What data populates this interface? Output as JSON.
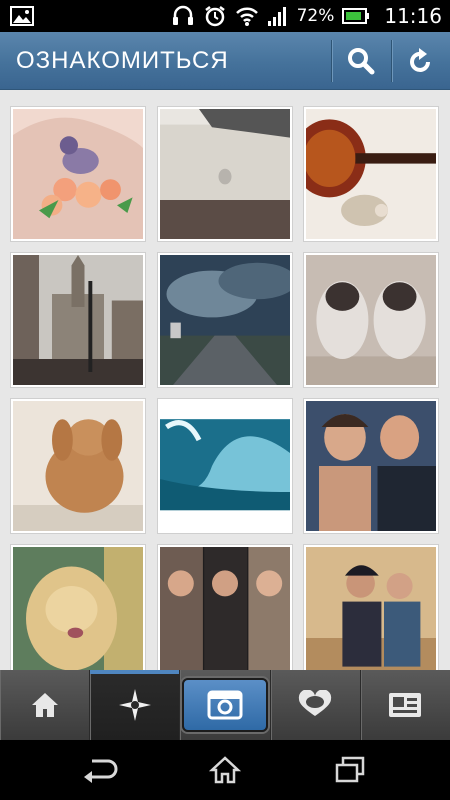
{
  "status_bar": {
    "battery_percent": "72%",
    "time": "11:16",
    "icons": [
      "image-icon",
      "headset-icon",
      "alarm-icon",
      "wifi-icon",
      "signal-icon",
      "battery-icon"
    ]
  },
  "action_bar": {
    "title": "ОЗНАКОМИТЬСЯ",
    "actions": [
      "search-icon",
      "refresh-icon"
    ]
  },
  "grid": {
    "items": [
      {
        "subject": "tattoo-bird-flowers",
        "colors": [
          "#e9c6b9",
          "#7d6b97"
        ]
      },
      {
        "subject": "laptop-apple-logo",
        "colors": [
          "#d8d4cc",
          "#5a4c47"
        ]
      },
      {
        "subject": "guitar-hedgehog",
        "colors": [
          "#efe8e0",
          "#7a2a1a"
        ]
      },
      {
        "subject": "city-street-tower",
        "colors": [
          "#a9a5a0",
          "#3b3532"
        ]
      },
      {
        "subject": "road-clouds",
        "colors": [
          "#3f5f7a",
          "#1d2a36"
        ]
      },
      {
        "subject": "two-pugs",
        "colors": [
          "#bdb4ae",
          "#5a4f4a"
        ]
      },
      {
        "subject": "rabbit",
        "colors": [
          "#eae1d5",
          "#b87a45"
        ]
      },
      {
        "subject": "ocean-wave-surfer",
        "colors": [
          "#5aa9c8",
          "#0f5c77"
        ]
      },
      {
        "subject": "two-men-selfie",
        "colors": [
          "#3a4d68",
          "#c99a7a"
        ]
      },
      {
        "subject": "golden-puppy",
        "colors": [
          "#d9c08a",
          "#4d6a4a"
        ]
      },
      {
        "subject": "group-photo-collage",
        "colors": [
          "#6c5b4f",
          "#1e1c1d"
        ]
      },
      {
        "subject": "two-girls-studio",
        "colors": [
          "#d6b789",
          "#2a2b3a"
        ]
      }
    ]
  },
  "tab_bar": {
    "tabs": [
      {
        "name": "home-icon"
      },
      {
        "name": "explore-icon",
        "active": true
      },
      {
        "name": "camera-icon"
      },
      {
        "name": "news-icon"
      },
      {
        "name": "profile-icon"
      }
    ]
  },
  "nav_bar": {
    "buttons": [
      "back-icon",
      "home-icon",
      "recent-apps-icon"
    ]
  }
}
